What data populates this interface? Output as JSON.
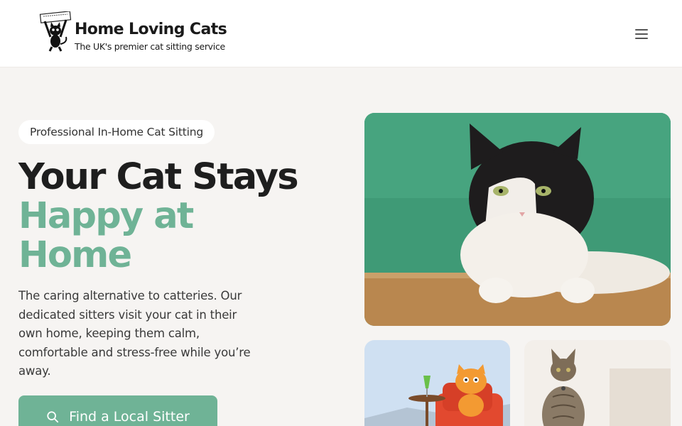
{
  "header": {
    "brand_name": "Home Loving Cats",
    "tagline": "The UK's premier cat sitting service",
    "logo_icon": "cat-holding-sign-logo",
    "menu_icon": "hamburger-menu-icon"
  },
  "hero": {
    "badge": "Professional In-Home Cat Sitting",
    "title_line1": "Your Cat Stays",
    "title_line2": "Happy at",
    "title_line3": "Home",
    "description": "The caring alternative to catteries. Our dedicated sitters visit your cat in their own home, keeping them calm, comfortable and stress-free while you’re away.",
    "cta_label": "Find a Local Sitter",
    "cta_icon": "search-icon"
  },
  "images": {
    "main": "photo-black-white-cat-green-wall",
    "secondary_1": "illustration-orange-cat-armchair",
    "secondary_2": "photo-tabby-cat-sitting"
  },
  "colors": {
    "accent": "#6fb396",
    "background": "#f6f4f2",
    "heading": "#1e1e1e"
  }
}
